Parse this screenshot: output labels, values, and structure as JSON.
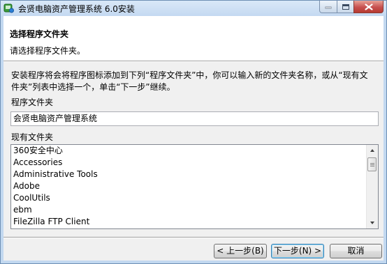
{
  "window": {
    "title": "会贤电脑资产管理系统 6.0安装",
    "app_icon": "installer-app-icon",
    "controls": {
      "minimize_icon": "minimize-icon",
      "maximize_icon": "maximize-icon",
      "close_icon": "close-icon"
    }
  },
  "header": {
    "title": "选择程序文件夹",
    "subtitle": "请选择程序文件夹。"
  },
  "body": {
    "description": "安装程序将会将程序图标添加到下列“程序文件夹”中，你可以输入新的文件夹名称，或从“现有文件夹”列表中选择一个，单击“下一步”继续。",
    "program_folder_label": "程序文件夹",
    "program_folder_value": "会贤电脑资产管理系统",
    "existing_folders_label": "现有文件夹",
    "existing_folders": [
      "360安全中心",
      "Accessories",
      "Administrative Tools",
      "Adobe",
      "CoolUtils",
      "ebm",
      "FileZilla FTP Client"
    ],
    "scroll_position": 0.05
  },
  "buttons": {
    "back": "< 上一步(B)",
    "next": "下一步(N) >",
    "cancel": "取消"
  },
  "colors": {
    "title_bar": "#c4d9f1",
    "close_button": "#c75050",
    "default_button_border": "#3c7fb1"
  }
}
